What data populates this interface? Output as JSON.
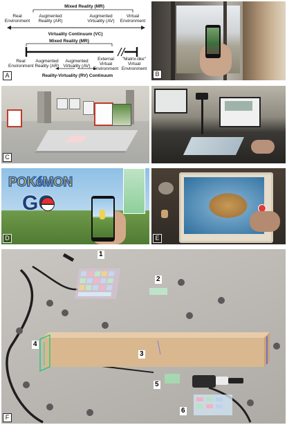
{
  "panel_a": {
    "label": "A",
    "top_mr": "Mixed Reality (MR)",
    "top_items": [
      "Real\nEnvironment",
      "Augmented\nReality (AR)",
      "Augmented\nVirtuality (AV)",
      "Virtual\nEnvironment"
    ],
    "vc_title": "Virtuality Continuum (VC)",
    "bottom_mr": "Mixed Reality (MR)",
    "bottom_items": [
      "Real\nEnvironment",
      "Augmented\nReality (AR)",
      "Augmented\nVirtuality (AV)",
      "External\nVirtual\nEnvironment",
      "\"Matrix-like\"\nVirtual\nEnvironment"
    ],
    "rv_title": "Reality-Virtuality (RV) Continuum"
  },
  "panel_b": {
    "label": "B"
  },
  "panel_c": {
    "label": "C"
  },
  "panel_d": {
    "label": "D",
    "logo_top": "POKéMON",
    "logo_bottom": "GO"
  },
  "panel_e": {
    "label": "E"
  },
  "panel_f": {
    "label": "F",
    "numbers": [
      "1",
      "2",
      "3",
      "4",
      "5",
      "6"
    ]
  }
}
